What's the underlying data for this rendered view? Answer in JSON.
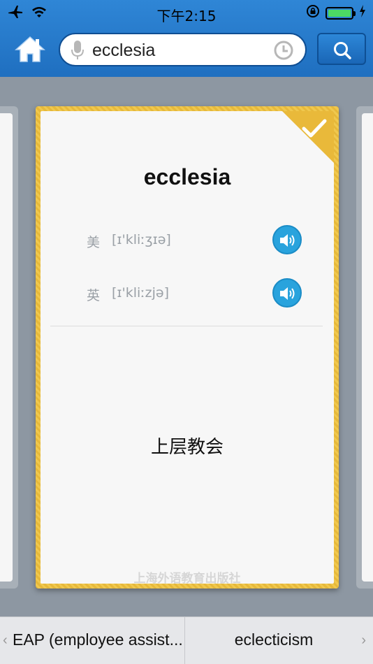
{
  "status_bar": {
    "time": "下午2:15"
  },
  "search": {
    "value": "ecclesia",
    "placeholder": ""
  },
  "card": {
    "word": "ecclesia",
    "pronunciations": [
      {
        "label": "美",
        "ipa": "[ɪ'kliːʒɪə]"
      },
      {
        "label": "英",
        "ipa": "[ɪ'kliːzjə]"
      }
    ],
    "meaning": "上层教会",
    "publisher": "上海外语教育出版社"
  },
  "bottom_nav": {
    "prev_label": "EAP (employee assist...",
    "next_label": "eclecticism"
  },
  "colors": {
    "header_blue": "#2f86d6",
    "card_border_gold": "#e9b93a",
    "speaker_blue": "#29a3dd",
    "battery_green": "#4cd964"
  },
  "icons": [
    "airplane-icon",
    "wifi-icon",
    "lock-rotation-icon",
    "battery-icon",
    "charging-icon",
    "home-icon",
    "microphone-icon",
    "history-icon",
    "search-icon",
    "checkmark-icon",
    "speaker-icon"
  ]
}
